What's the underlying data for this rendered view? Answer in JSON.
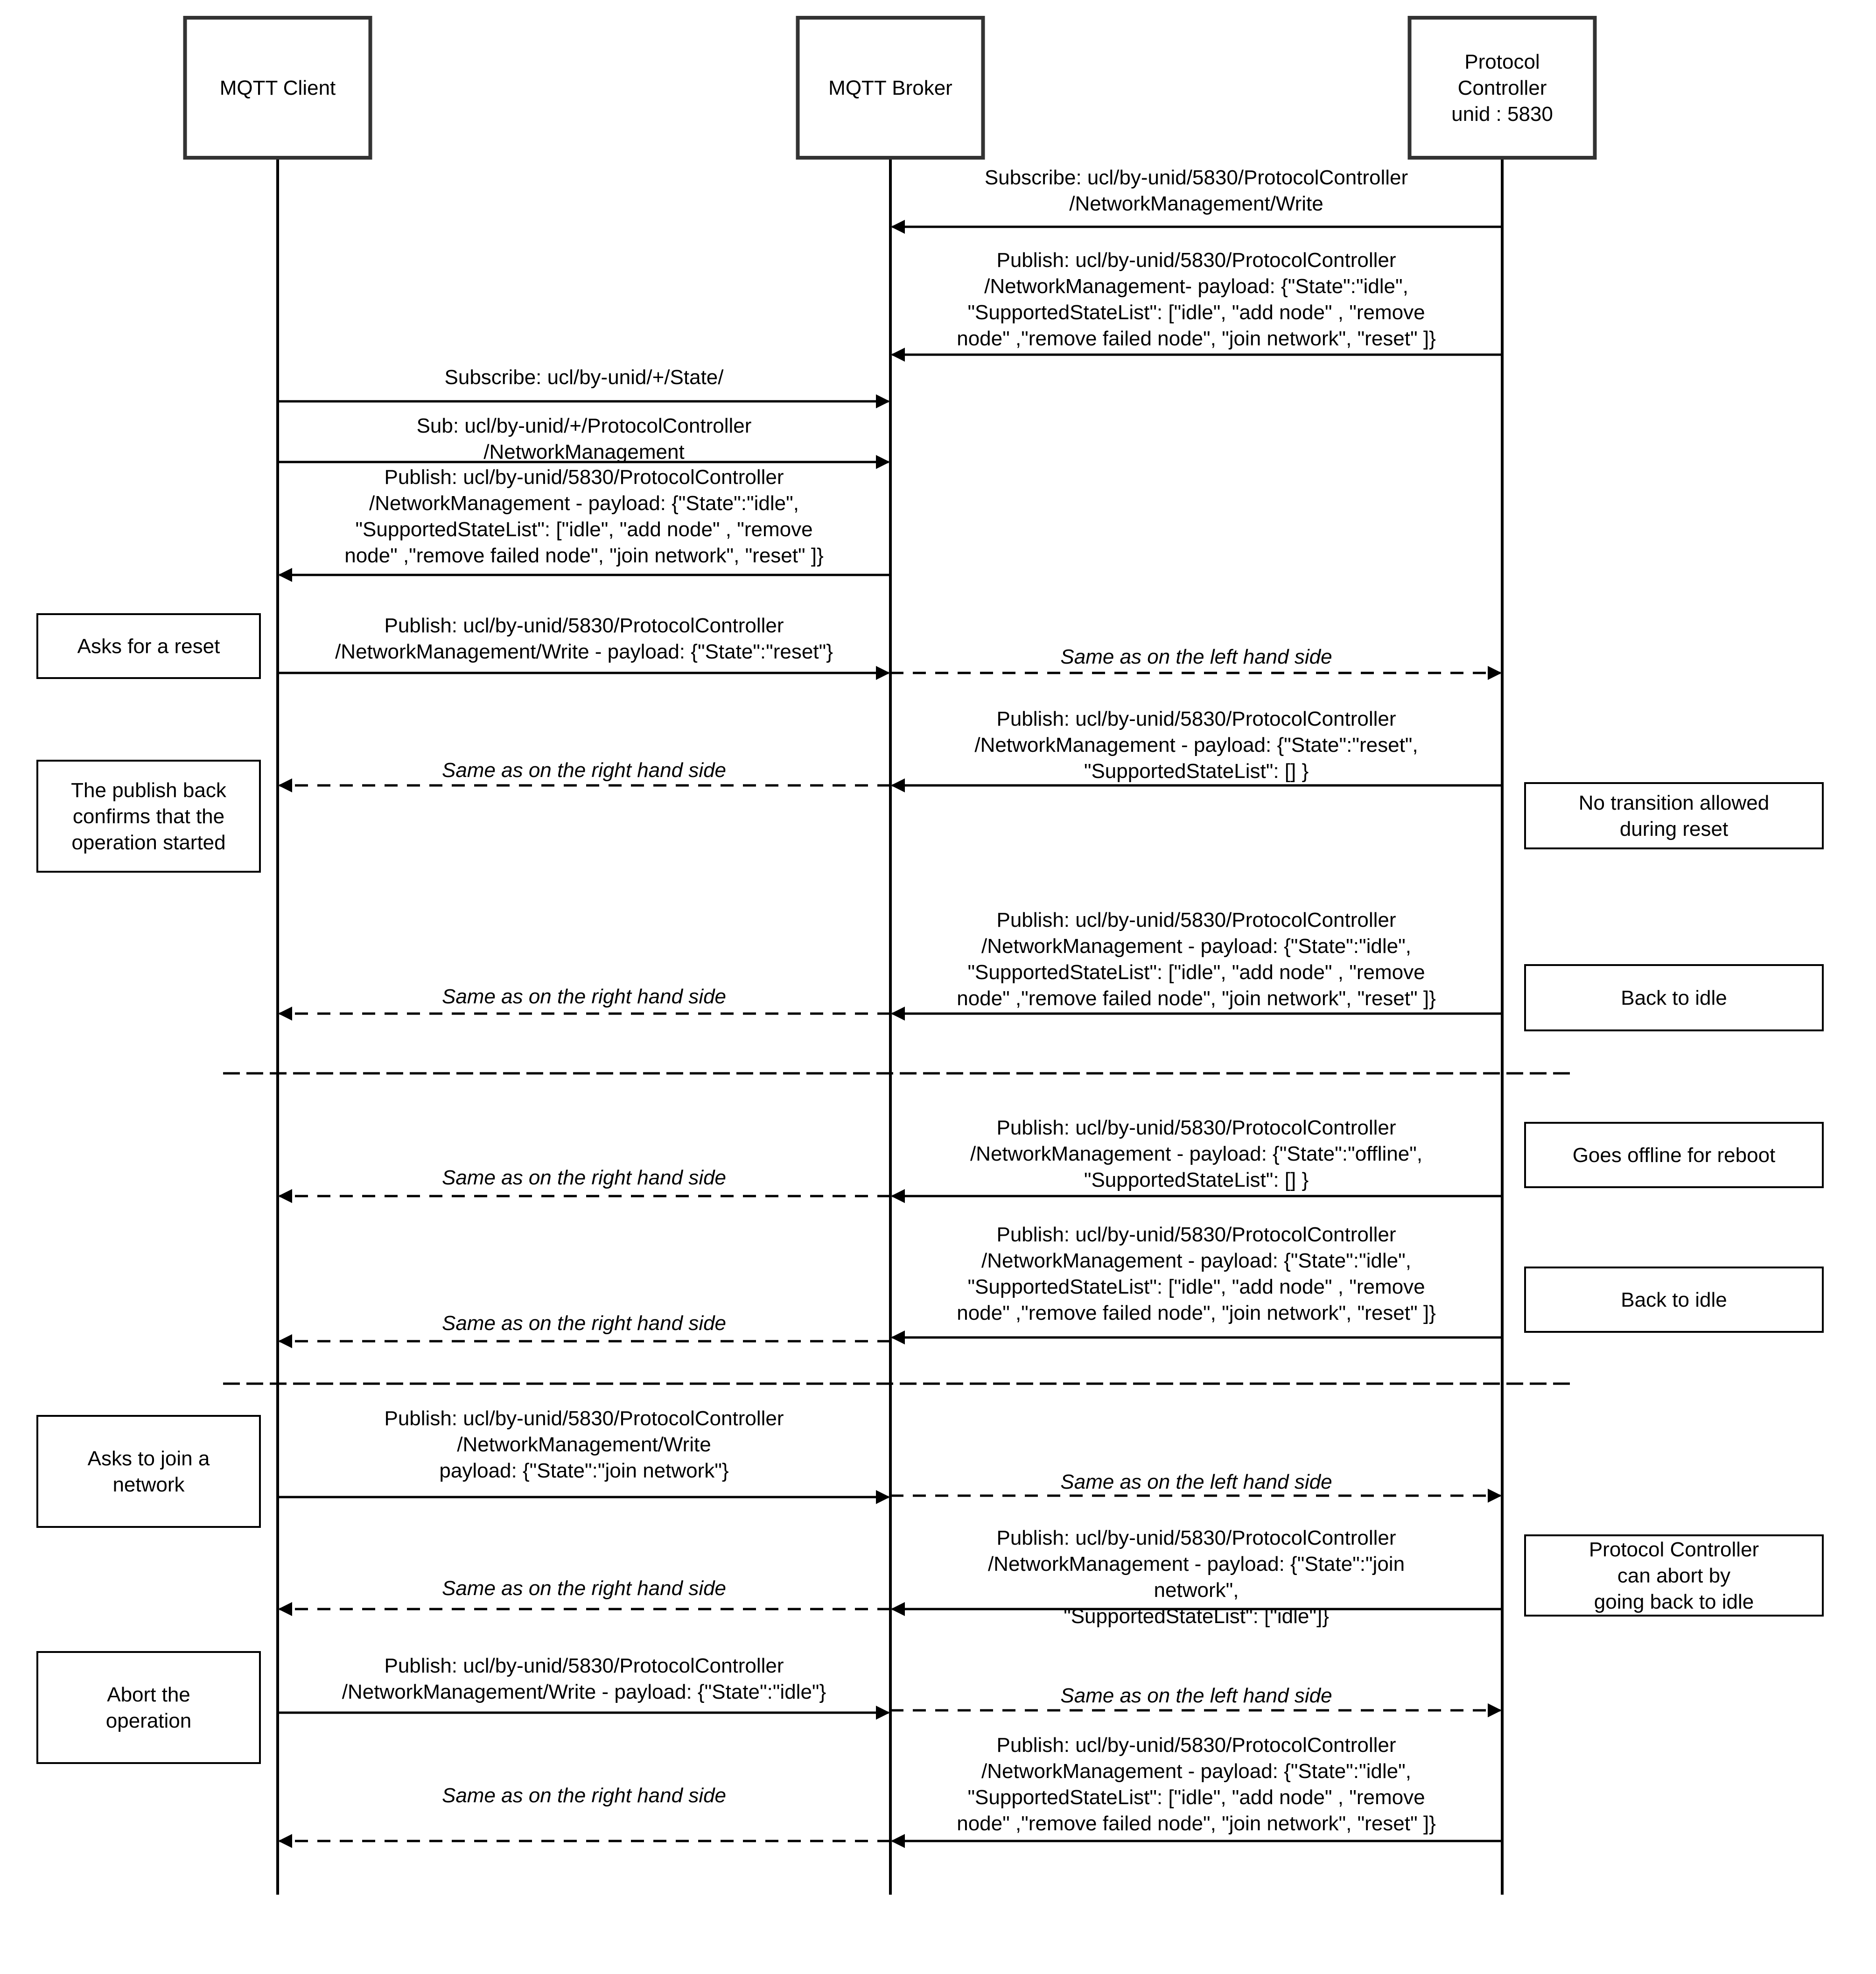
{
  "diagram": {
    "type": "sequence",
    "actors": [
      {
        "id": "client",
        "lines": [
          "MQTT Client"
        ]
      },
      {
        "id": "broker",
        "lines": [
          "MQTT Broker"
        ]
      },
      {
        "id": "pc",
        "lines": [
          "Protocol",
          "Controller",
          "unid : 5830"
        ]
      }
    ],
    "messages": [
      {
        "from": "pc",
        "to": "broker",
        "style": "solid",
        "italic": false,
        "lines": [
          "Subscribe: ucl/by-unid/5830/ProtocolController",
          "/NetworkManagement/Write"
        ]
      },
      {
        "from": "pc",
        "to": "broker",
        "style": "solid",
        "italic": false,
        "lines": [
          "Publish: ucl/by-unid/5830/ProtocolController",
          "/NetworkManagement- payload: {\"State\":\"idle\",",
          "\"SupportedStateList\": [\"idle\", \"add node\" , \"remove",
          "node\" ,\"remove failed node\", \"join network\", \"reset\" ]}"
        ]
      },
      {
        "from": "client",
        "to": "broker",
        "style": "solid",
        "italic": false,
        "lines": [
          "Subscribe: ucl/by-unid/+/State/"
        ]
      },
      {
        "from": "client",
        "to": "broker",
        "style": "solid",
        "italic": false,
        "lines": [
          "Sub: ucl/by-unid/+/ProtocolController",
          "/NetworkManagement"
        ]
      },
      {
        "from": "broker",
        "to": "client",
        "style": "solid",
        "italic": false,
        "lines": [
          "Publish: ucl/by-unid/5830/ProtocolController",
          "/NetworkManagement - payload: {\"State\":\"idle\",",
          "\"SupportedStateList\": [\"idle\", \"add node\" , \"remove",
          "node\" ,\"remove failed node\", \"join network\", \"reset\" ]}"
        ]
      },
      {
        "from": "client",
        "to": "broker",
        "style": "solid",
        "italic": false,
        "lines": [
          "Publish: ucl/by-unid/5830/ProtocolController",
          "/NetworkManagement/Write - payload: {\"State\":\"reset\"}"
        ]
      },
      {
        "from": "broker",
        "to": "pc",
        "style": "dashed",
        "italic": true,
        "lines": [
          "Same as on the left hand side"
        ]
      },
      {
        "from": "pc",
        "to": "broker",
        "style": "solid",
        "italic": false,
        "lines": [
          "Publish: ucl/by-unid/5830/ProtocolController",
          "/NetworkManagement - payload: {\"State\":\"reset\",",
          "\"SupportedStateList\": [] }"
        ]
      },
      {
        "from": "broker",
        "to": "client",
        "style": "dashed",
        "italic": true,
        "lines": [
          "Same as on the right hand side"
        ]
      },
      {
        "from": "pc",
        "to": "broker",
        "style": "solid",
        "italic": false,
        "lines": [
          "Publish: ucl/by-unid/5830/ProtocolController",
          "/NetworkManagement - payload: {\"State\":\"idle\",",
          "\"SupportedStateList\": [\"idle\", \"add node\" , \"remove",
          "node\" ,\"remove failed node\", \"join network\", \"reset\" ]}"
        ]
      },
      {
        "from": "broker",
        "to": "client",
        "style": "dashed",
        "italic": true,
        "lines": [
          "Same as on the right hand side"
        ]
      },
      {
        "from": "pc",
        "to": "broker",
        "style": "solid",
        "italic": false,
        "lines": [
          "Publish: ucl/by-unid/5830/ProtocolController",
          "/NetworkManagement - payload: {\"State\":\"offline\",",
          "\"SupportedStateList\": [] }"
        ]
      },
      {
        "from": "broker",
        "to": "client",
        "style": "dashed",
        "italic": true,
        "lines": [
          "Same as on the right hand side"
        ]
      },
      {
        "from": "pc",
        "to": "broker",
        "style": "solid",
        "italic": false,
        "lines": [
          "Publish: ucl/by-unid/5830/ProtocolController",
          "/NetworkManagement - payload: {\"State\":\"idle\",",
          "\"SupportedStateList\": [\"idle\", \"add node\" , \"remove",
          "node\" ,\"remove failed node\", \"join network\", \"reset\" ]}"
        ]
      },
      {
        "from": "broker",
        "to": "client",
        "style": "dashed",
        "italic": true,
        "lines": [
          "Same as on the right hand side"
        ]
      },
      {
        "from": "client",
        "to": "broker",
        "style": "solid",
        "italic": false,
        "lines": [
          "Publish: ucl/by-unid/5830/ProtocolController",
          "/NetworkManagement/Write",
          "payload: {\"State\":\"join network\"}"
        ]
      },
      {
        "from": "broker",
        "to": "pc",
        "style": "dashed",
        "italic": true,
        "lines": [
          "Same as on the left hand side"
        ]
      },
      {
        "from": "pc",
        "to": "broker",
        "style": "solid",
        "italic": false,
        "lines": [
          "Publish: ucl/by-unid/5830/ProtocolController",
          "/NetworkManagement - payload: {\"State\":\"join",
          "network\",",
          "\"SupportedStateList\": [\"idle\"]}"
        ]
      },
      {
        "from": "broker",
        "to": "client",
        "style": "dashed",
        "italic": true,
        "lines": [
          "Same as on the right hand side"
        ]
      },
      {
        "from": "client",
        "to": "broker",
        "style": "solid",
        "italic": false,
        "lines": [
          "Publish: ucl/by-unid/5830/ProtocolController",
          "/NetworkManagement/Write - payload: {\"State\":\"idle\"}"
        ]
      },
      {
        "from": "broker",
        "to": "pc",
        "style": "dashed",
        "italic": true,
        "lines": [
          "Same as on the left hand side"
        ]
      },
      {
        "from": "pc",
        "to": "broker",
        "style": "solid",
        "italic": false,
        "lines": [
          "Publish: ucl/by-unid/5830/ProtocolController",
          "/NetworkManagement - payload: {\"State\":\"idle\",",
          "\"SupportedStateList\": [\"idle\", \"add node\" , \"remove",
          "node\" ,\"remove failed node\", \"join network\", \"reset\" ]}"
        ]
      },
      {
        "from": "broker",
        "to": "client",
        "style": "dashed",
        "italic": true,
        "lines": [
          "Same as on the right hand side"
        ]
      }
    ],
    "notes": [
      {
        "side": "left",
        "lines": [
          "Asks for a reset"
        ]
      },
      {
        "side": "left",
        "lines": [
          "The publish back",
          "confirms that the",
          "operation started"
        ]
      },
      {
        "side": "right",
        "lines": [
          "No transition allowed",
          "during reset"
        ]
      },
      {
        "side": "right",
        "lines": [
          "Back to idle"
        ]
      },
      {
        "side": "right",
        "lines": [
          "Goes offline for reboot"
        ]
      },
      {
        "side": "right",
        "lines": [
          "Back to idle"
        ]
      },
      {
        "side": "left",
        "lines": [
          "Asks to join a",
          "network"
        ]
      },
      {
        "side": "right",
        "lines": [
          "Protocol Controller",
          "can abort by",
          "going back to idle"
        ]
      },
      {
        "side": "left",
        "lines": [
          "Abort the",
          "operation"
        ]
      }
    ],
    "separators": 2
  }
}
